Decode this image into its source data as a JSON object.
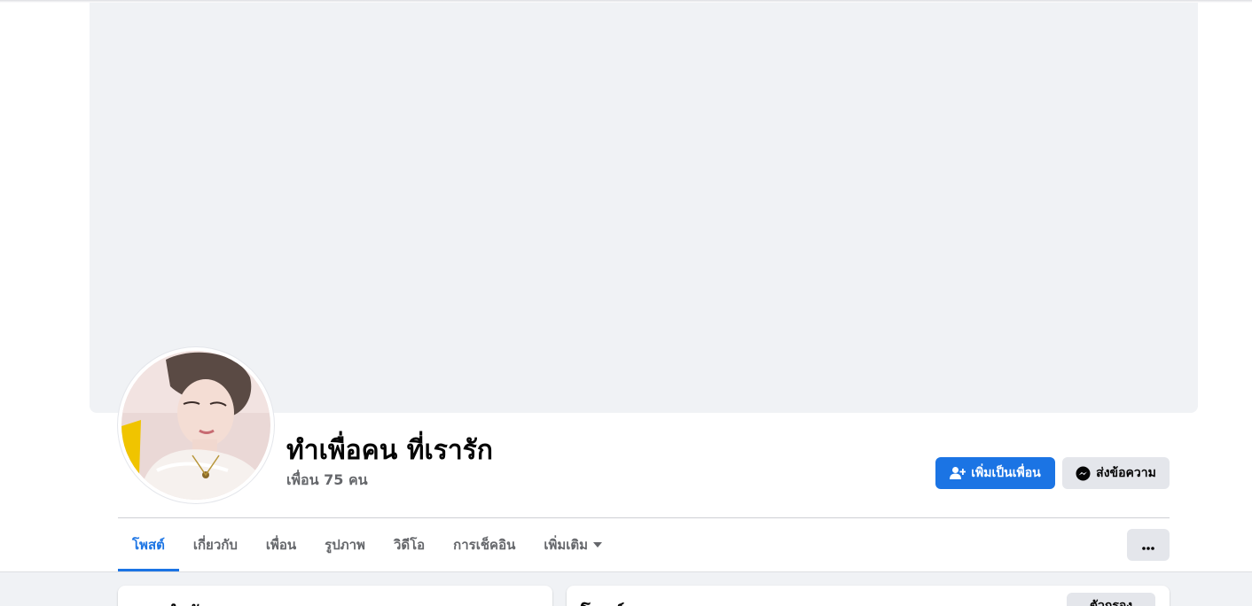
{
  "profile": {
    "name": "ทำเพื่อคน ที่เรารัก",
    "friends_count_label": "เพื่อน 75 คน"
  },
  "actions": {
    "add_friend_label": "เพิ่มเป็นเพื่อน",
    "add_friend_icon": "add-friend-icon",
    "message_label": "ส่งข้อความ",
    "message_icon": "messenger-icon",
    "more_icon": "ellipsis-icon"
  },
  "tabs": [
    {
      "label": "โพสต์",
      "active": true
    },
    {
      "label": "เกี่ยวกับ"
    },
    {
      "label": "เพื่อน"
    },
    {
      "label": "รูปภาพ"
    },
    {
      "label": "วิดีโอ"
    },
    {
      "label": "การเช็คอิน"
    },
    {
      "label": "เพิ่มเติม",
      "icon": "caret-down-icon"
    }
  ],
  "cards": {
    "intro_title": "แนะนำตัว",
    "posts_title": "โพสต์",
    "filter_label": "ตัวกรอง"
  },
  "colors": {
    "accent": "#1b74e4",
    "cover": "#f0f2f5",
    "secondary_button": "#e4e6eb",
    "muted_text": "#65676b"
  }
}
